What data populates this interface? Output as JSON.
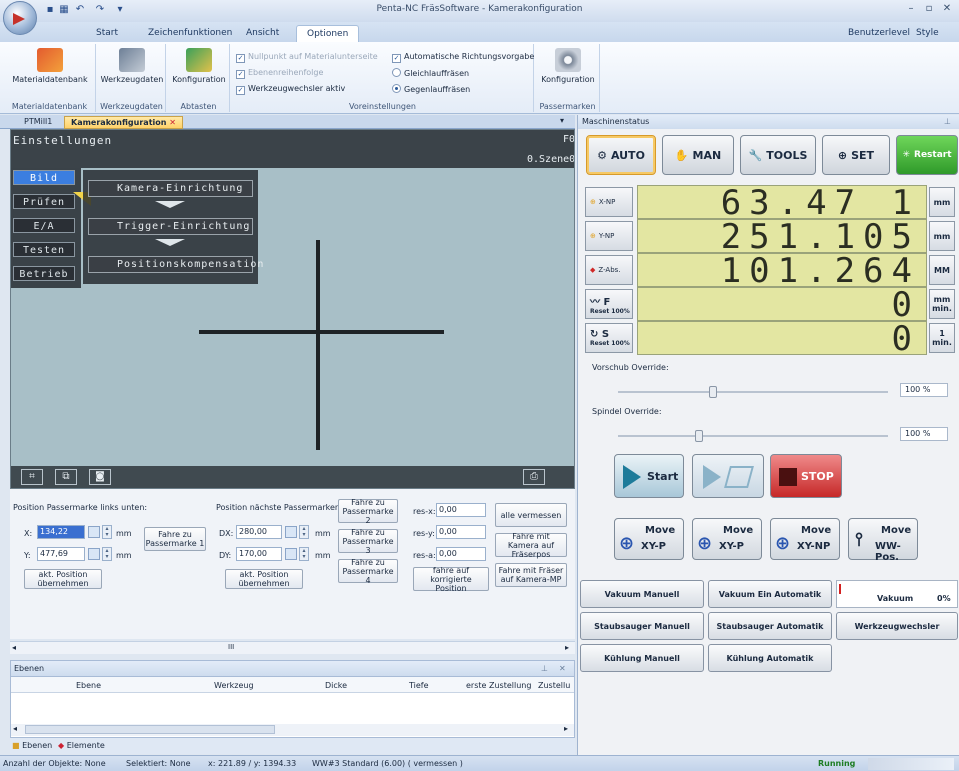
{
  "window": {
    "title": "Penta-NC FräsSoftware - Kamerakonfiguration"
  },
  "ribbon_tabs": [
    "Start",
    "Zeichenfunktionen",
    "Ansicht",
    "Optionen"
  ],
  "ribbon_right": {
    "benutzerlevel": "Benutzerlevel",
    "style": "Style"
  },
  "ribbon": {
    "materialdatenbank": {
      "button": "Materialdatenbank",
      "group": "Materialdatenbank"
    },
    "werkzeugdaten": {
      "button": "Werkzeugdaten",
      "group": "Werkzeugdaten"
    },
    "abtasten": {
      "button": "Konfiguration",
      "group": "Abtasten"
    },
    "voreinstellungen": {
      "group": "Voreinstellungen",
      "nullpunkt": "Nullpunkt auf Materialunterseite",
      "ebenenreihenfolge": "Ebenenreihenfolge",
      "werkzeugwechsler": "Werkzeugwechsler aktiv",
      "auto_richtung": "Automatische Richtungsvorgabe",
      "gleichlauf": "Gleichlauffräsen",
      "gegenlauf": "Gegenlauffräsen"
    },
    "passermarken": {
      "button": "Konfiguration",
      "group": "Passermarken"
    }
  },
  "doc_tabs": [
    "PTMill1",
    "Kamerakonfiguration"
  ],
  "camera": {
    "header_left": "Einstellungen",
    "header_right_1": "F0",
    "header_right_2": "0.Szene0",
    "menu": [
      "Bild",
      "Prüfen",
      "E/A",
      "Testen",
      "Betrieb"
    ],
    "setup": [
      "Kamera-Einrichtung",
      "Trigger-Einrichtung",
      "Positionskompensation"
    ]
  },
  "controls": {
    "pos_links_unten": "Position Passermarke links unten:",
    "pos_naechste": "Position nächste Passermarken:",
    "x_label": "X:",
    "x_value": "134,22",
    "y_label": "Y:",
    "y_value": "477,69",
    "dx_label": "DX:",
    "dx_value": "280,00",
    "dy_label": "DY:",
    "dy_value": "170,00",
    "mm": "mm",
    "fahre_pm1": "Fahre zu Passermarke 1",
    "akt_position_1": "akt. Position übernehmen",
    "akt_position_2": "akt. Position übernehmen",
    "fahre_pm2": "Fahre zu Passermarke 2",
    "fahre_pm3": "Fahre zu Passermarke 3",
    "fahre_pm4": "Fahre zu Passermarke 4",
    "res_x_label": "res-x:",
    "res_x": "0,00",
    "res_y_label": "res-y:",
    "res_y": "0,00",
    "res_a_label": "res-a:",
    "res_a": "0,00",
    "fahre_korr": "fahre auf korrigierte Position",
    "alle_vermessen": "alle vermessen",
    "fahre_kamera": "Fahre mit Kamera auf Fräserpos",
    "fahre_fraeser": "Fahre mit Fräser auf Kamera-MP"
  },
  "scroll": {
    "mark": "III"
  },
  "ebenen": {
    "title": "Ebenen",
    "columns": [
      "Ebene",
      "Werkzeug",
      "Dicke",
      "Tiefe",
      "erste Zustellung",
      "Zustellu"
    ]
  },
  "bottom_tabs": [
    "Ebenen",
    "Elemente"
  ],
  "statusbar": {
    "objects": "Anzahl der Objekte: None",
    "selected": "Selektiert: None",
    "coords": "x:  221.89 / y:  1394.33",
    "tool": "WW#3 Standard (6.00) ( vermessen )",
    "running": "Running"
  },
  "machine": {
    "title": "Maschinenstatus",
    "modes": [
      "AUTO",
      "MAN",
      "TOOLS",
      "SET",
      "Restart"
    ],
    "axes": [
      {
        "label": "X-NP",
        "value": "63.47 1",
        "unit": "mm"
      },
      {
        "label": "Y-NP",
        "value": "251.105",
        "unit": "mm"
      },
      {
        "label": "Z-Abs.",
        "value": "101.264",
        "unit": "MM"
      },
      {
        "label": "F",
        "sub": "Reset 100%",
        "value": "0",
        "unit": "mm min."
      },
      {
        "label": "S",
        "sub": "Reset 100%",
        "value": "0",
        "unit": "1 min."
      }
    ],
    "vorschub_label": "Vorschub Override:",
    "vorschub_value": "100 %",
    "vorschub_level": 0.35,
    "spindel_label": "Spindel Override:",
    "spindel_value": "100 %",
    "spindel_level": 0.3,
    "start": "Start",
    "stop": "STOP",
    "moves": [
      {
        "top": "Move",
        "bottom": "XY-P"
      },
      {
        "top": "Move",
        "bottom": "XY-P"
      },
      {
        "top": "Move",
        "bottom": "XY-NP"
      },
      {
        "top": "Move",
        "bottom": "WW-Pos."
      }
    ],
    "vacuum": [
      [
        "Vakuum Manuell",
        "Vakuum Ein Automatik"
      ],
      [
        "Staubsauger Manuell",
        "Staubsauger Automatik",
        "Werkzeugwechsler"
      ],
      [
        "Kühlung Manuell",
        "Kühlung Automatik"
      ]
    ],
    "vakuum_label": "Vakuum",
    "vakuum_pct": "0%"
  }
}
